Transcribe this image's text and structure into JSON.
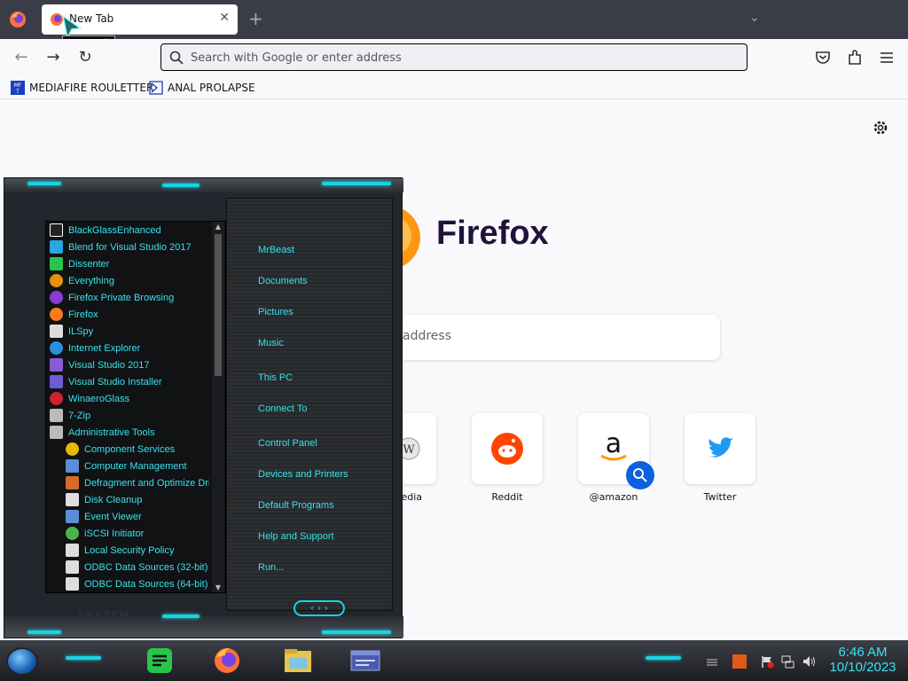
{
  "browser": {
    "tab": {
      "title": "New Tab",
      "tooltip": "New Tab"
    },
    "urlbar": {
      "placeholder": "Search with Google or enter address"
    },
    "bookmarks": [
      {
        "label": "MEDIAFIRE ROULETTER",
        "icon": "mediafire-icon"
      },
      {
        "label": "ANAL PROLAPSE",
        "icon": "bookmark-site-icon"
      }
    ]
  },
  "newtab": {
    "brand": "Firefox",
    "search_placeholder": "address",
    "sites": [
      {
        "label": "edia",
        "icon": "wikipedia-icon"
      },
      {
        "label": "Reddit",
        "icon": "reddit-icon"
      },
      {
        "label": "@amazon",
        "icon": "amazon-icon"
      },
      {
        "label": "Twitter",
        "icon": "twitter-icon"
      }
    ]
  },
  "startmenu": {
    "programs": [
      {
        "label": "BlackGlassEnhanced",
        "color": "#ffffff"
      },
      {
        "label": "Blend for Visual Studio 2017",
        "color": "#2aa6e0"
      },
      {
        "label": "Dissenter",
        "color": "#27c64b"
      },
      {
        "label": "Everything",
        "color": "#e8900c"
      },
      {
        "label": "Firefox Private Browsing",
        "color": "#8a3cd6"
      },
      {
        "label": "Firefox",
        "color": "#ff7a1a"
      },
      {
        "label": "ILSpy",
        "color": "#dddddd"
      },
      {
        "label": "Internet Explorer",
        "color": "#2b8fe0"
      },
      {
        "label": "Visual Studio 2017",
        "color": "#8a5bd6"
      },
      {
        "label": "Visual Studio Installer",
        "color": "#6e5bd6"
      },
      {
        "label": "WinaeroGlass",
        "color": "#cc2233"
      },
      {
        "label": "7-Zip",
        "color": "#bbbbbb"
      },
      {
        "label": "Administrative Tools",
        "color": "#bbbbbb"
      }
    ],
    "admin_tools": [
      {
        "label": "Component Services",
        "color": "#e6b800"
      },
      {
        "label": "Computer Management",
        "color": "#5b8ed6"
      },
      {
        "label": "Defragment and Optimize Drives",
        "color": "#d66a2a"
      },
      {
        "label": "Disk Cleanup",
        "color": "#dddddd"
      },
      {
        "label": "Event Viewer",
        "color": "#5b8ed6"
      },
      {
        "label": "iSCSI Initiator",
        "color": "#4ab34a"
      },
      {
        "label": "Local Security Policy",
        "color": "#dddddd"
      },
      {
        "label": "ODBC Data Sources (32-bit)",
        "color": "#dddddd"
      },
      {
        "label": "ODBC Data Sources (64-bit)",
        "color": "#dddddd"
      }
    ],
    "places": [
      "MrBeast",
      "Documents",
      "Pictures",
      "Music",
      "This PC",
      "Connect To",
      "Control Panel",
      "Devices and Printers",
      "Default Programs",
      "Help and Support",
      "Run..."
    ],
    "footer": "SYSTEM"
  },
  "taskbar": {
    "time": "6:46 AM",
    "date": "10/10/2023",
    "accent": "#37e3ee"
  }
}
